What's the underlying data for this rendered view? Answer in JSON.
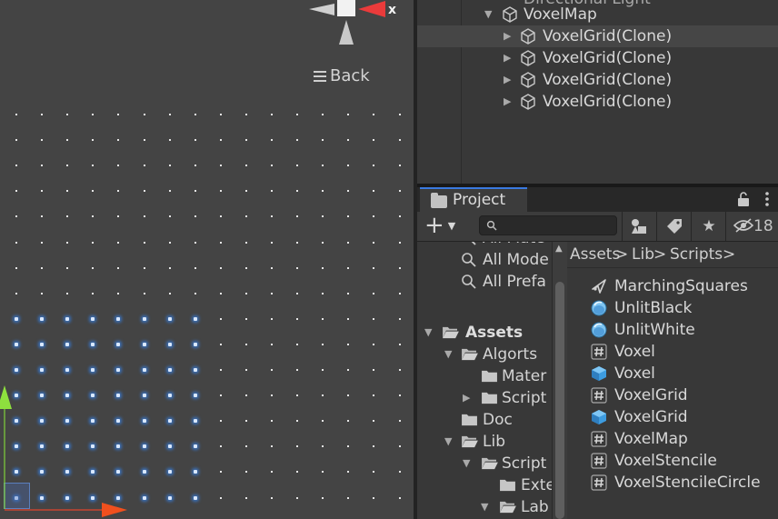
{
  "scene": {
    "back_label": "Back",
    "gizmo_axis_label": "x"
  },
  "hierarchy": {
    "parent_partial_label": "Directional Light",
    "map_label": "VoxelMap",
    "children": [
      {
        "label": "VoxelGrid(Clone)",
        "selected": true
      },
      {
        "label": "VoxelGrid(Clone)",
        "selected": false
      },
      {
        "label": "VoxelGrid(Clone)",
        "selected": false
      },
      {
        "label": "VoxelGrid(Clone)",
        "selected": false
      }
    ]
  },
  "project": {
    "tab_label": "Project",
    "add_label": "+",
    "hidden_count": "18",
    "search_placeholder": "",
    "favorites": [
      {
        "label": "All Mate"
      },
      {
        "label": "All Mode"
      },
      {
        "label": "All Prefa"
      }
    ],
    "tree": [
      {
        "label": "Assets",
        "bold": true
      },
      {
        "label": "Algorts"
      },
      {
        "label": "Mater"
      },
      {
        "label": "Script"
      },
      {
        "label": "Doc"
      },
      {
        "label": "Lib"
      },
      {
        "label": "Script"
      },
      {
        "label": "Exte"
      },
      {
        "label": "Lab"
      }
    ],
    "breadcrumb": [
      "Assets",
      "Lib",
      "Scripts"
    ],
    "assets": [
      {
        "label": "MarchingSquares",
        "icon": "shader-graph-icon"
      },
      {
        "label": "UnlitBlack",
        "icon": "material-icon"
      },
      {
        "label": "UnlitWhite",
        "icon": "material-icon"
      },
      {
        "label": "Voxel",
        "icon": "csharp-script-icon"
      },
      {
        "label": "Voxel",
        "icon": "prefab-icon"
      },
      {
        "label": "VoxelGrid",
        "icon": "csharp-script-icon"
      },
      {
        "label": "VoxelGrid",
        "icon": "prefab-icon"
      },
      {
        "label": "VoxelMap",
        "icon": "csharp-script-icon"
      },
      {
        "label": "VoxelStencile",
        "icon": "csharp-script-icon"
      },
      {
        "label": "VoxelStencileCircle",
        "icon": "csharp-script-icon"
      }
    ]
  }
}
